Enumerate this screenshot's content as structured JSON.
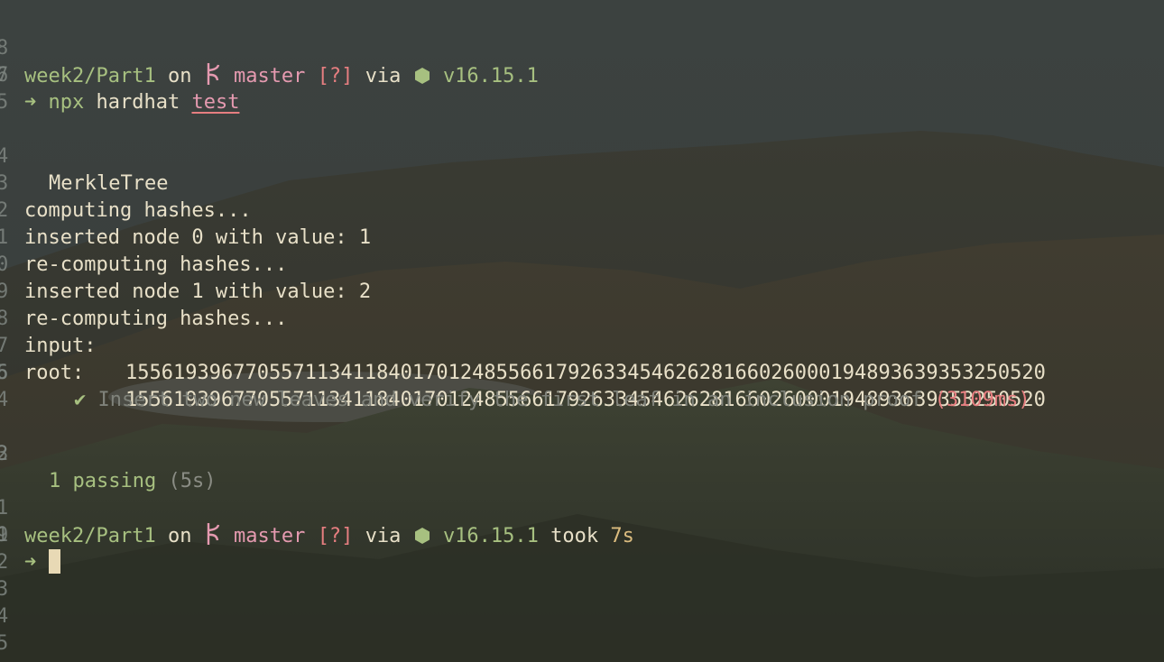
{
  "line_numbers": [
    "8",
    "7",
    "6",
    "5",
    "4",
    "3",
    "2",
    "1",
    "0",
    "9",
    "8",
    "7",
    "6",
    "5",
    "4",
    "3",
    "2",
    "1",
    "9",
    "1",
    "2",
    "3",
    "4",
    "5"
  ],
  "prompt1": {
    "dir": "week2/Part1",
    "on": "on",
    "branch": "master",
    "status": "[?]",
    "via": "via",
    "node_version": "v16.15.1"
  },
  "command": {
    "arrow": "➜",
    "npx": "npx",
    "hardhat": "hardhat",
    "arg": "test"
  },
  "output": {
    "suite": "MerkleTree",
    "log1": "computing hashes...",
    "log2": "inserted node 0 with value: 1",
    "log3": "re-computing hashes...",
    "log4": "inserted node 1 with value: 2",
    "log5": "re-computing hashes...",
    "input_label": "input:",
    "input_value": "15561939677055711341184017012485566179263345462628166026000194893639353250520",
    "root_label": "root:",
    "root_value": "15561939677055711341184017012485566179263345462628166026000194893639353250520",
    "check": "✔",
    "test_name": "Insert two new leaves and verify the first leaf in an inclusion proof",
    "test_time": "(3109ms)",
    "passing": "1 passing",
    "duration": "(5s)"
  },
  "prompt2": {
    "dir": "week2/Part1",
    "on": "on",
    "branch": "master",
    "status": "[?]",
    "via": "via",
    "node_version": "v16.15.1",
    "took": "took",
    "elapsed": "7s",
    "arrow": "➜"
  },
  "icons": {
    "branch": "git-branch-icon",
    "node": "nodejs-hexagon-icon",
    "cursor": "block-cursor"
  },
  "colors": {
    "green": "#a7c080",
    "red": "#e67e80",
    "pink": "#e59ab0",
    "yellow": "#dbbc7f",
    "text": "#e8e0c8"
  }
}
